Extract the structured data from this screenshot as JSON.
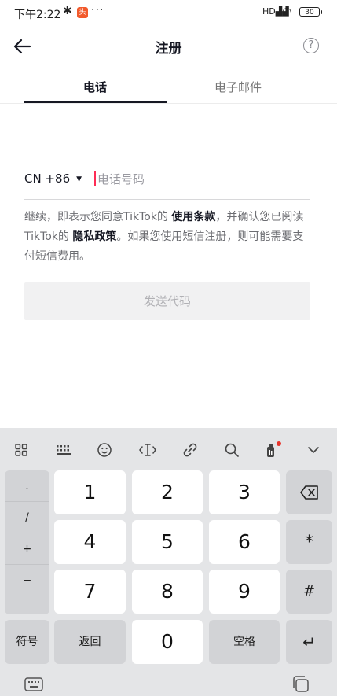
{
  "status_bar": {
    "time": "下午2:22",
    "bt_glyph": "✱",
    "app_badge": "头",
    "dots": "···",
    "signal": "HD▟▟",
    "wifi_glyph": "◠",
    "battery": "30"
  },
  "header": {
    "title": "注册",
    "help": "?"
  },
  "tabs": [
    {
      "label": "电话",
      "active": true
    },
    {
      "label": "电子邮件",
      "active": false
    }
  ],
  "phone_form": {
    "country_code": "CN +86",
    "dropdown_glyph": "▼",
    "placeholder": "电话号码",
    "terms_prefix": "继续，即表示您同意TikTok的 ",
    "terms_link": "使用条款",
    "terms_middle": "，并确认您已阅读TikTok的 ",
    "privacy_link": "隐私政策",
    "terms_suffix": "。如果您使用短信注册，则可能需要支付短信费用。",
    "send_button": "发送代码"
  },
  "keyboard": {
    "toolbar_icons": [
      "grid-icon",
      "keyboard-layout-icon",
      "emoji-icon",
      "cursor-move-icon",
      "clipboard-link-icon",
      "search-icon",
      "voice-icon",
      "collapse-icon"
    ],
    "symbols": [
      ".",
      "/",
      "+",
      "−",
      ""
    ],
    "digits": [
      "1",
      "2",
      "3",
      "4",
      "5",
      "6",
      "7",
      "8",
      "9"
    ],
    "backspace": "⌫",
    "asterisk": "*",
    "hash": "#",
    "symbol_key": "符号",
    "back_key": "返回",
    "zero": "0",
    "space_key": "空格",
    "enter": "↵"
  }
}
